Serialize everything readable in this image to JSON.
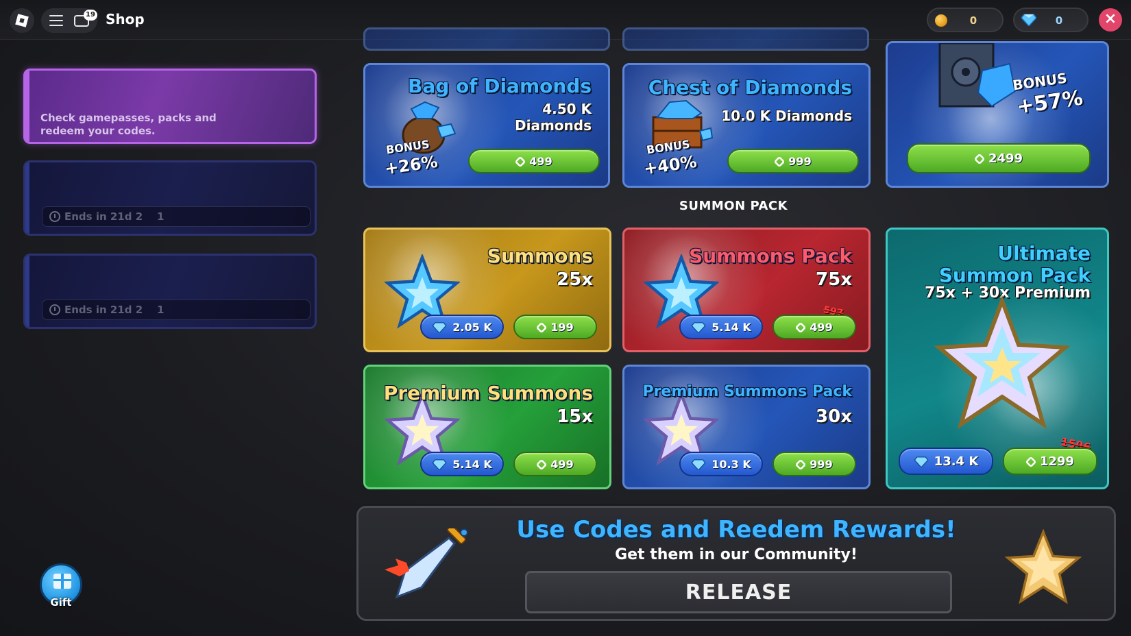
{
  "topbar": {
    "title": "Shop",
    "chat_badge": "19",
    "coins": "0",
    "gems": "0",
    "close_glyph": "×"
  },
  "sidebar": {
    "promo_text": "Check gamepasses, packs and redeem your codes.",
    "events": [
      {
        "timer": "Ends in 21d 2    1"
      },
      {
        "timer": "Ends in 21d 2    1"
      }
    ],
    "gift_label": "Gift"
  },
  "diamond_packs": [
    {
      "title": "Bag of Diamonds",
      "amount": "4.50 K",
      "unit": "Diamonds",
      "bonus_label": "BONUS",
      "bonus_value": "+26%",
      "price": "499"
    },
    {
      "title": "Chest of Diamonds",
      "amount": "10.0 K Diamonds",
      "bonus_label": "BONUS",
      "bonus_value": "+40%",
      "price": "999"
    },
    {
      "bonus_label": "BONUS",
      "bonus_value": "+57%",
      "price": "2499"
    }
  ],
  "section_title": "SUMMON PACK",
  "summon_packs": [
    {
      "title": "Summons",
      "qty": "25x",
      "gem_price": "2.05 K",
      "robux_price": "199"
    },
    {
      "title": "Summons Pack",
      "qty": "75x",
      "gem_price": "5.14 K",
      "robux_price": "499",
      "old_price": "597"
    },
    {
      "title": "Premium Summons",
      "qty": "15x",
      "gem_price": "5.14 K",
      "robux_price": "499"
    },
    {
      "title": "Premium Summons Pack",
      "qty": "30x",
      "gem_price": "10.3 K",
      "robux_price": "999"
    },
    {
      "title_line1": "Ultimate",
      "title_line2": "Summon Pack",
      "qty": "75x + 30x Premium",
      "gem_price": "13.4 K",
      "robux_price": "1299",
      "old_price": "1596"
    }
  ],
  "redeem": {
    "title": "Use Codes and Reedem Rewards!",
    "subtitle": "Get them in our Community!",
    "code_value": "RELEASE"
  },
  "colors": {
    "accent_blue": "#3fb4ff",
    "robux_green": "#4eaa24",
    "gem_blue": "#2358d0",
    "close_pink": "#e3456a",
    "strike_red": "#ff3b3b"
  },
  "icons": [
    "roblox-logo-icon",
    "hamburger-menu-icon",
    "chat-icon",
    "coin-icon",
    "gem-icon",
    "close-icon",
    "clock-icon",
    "gift-icon",
    "robux-icon",
    "diamond-bag-icon",
    "diamond-chest-icon",
    "vault-icon",
    "star-icon",
    "sword-icon"
  ]
}
